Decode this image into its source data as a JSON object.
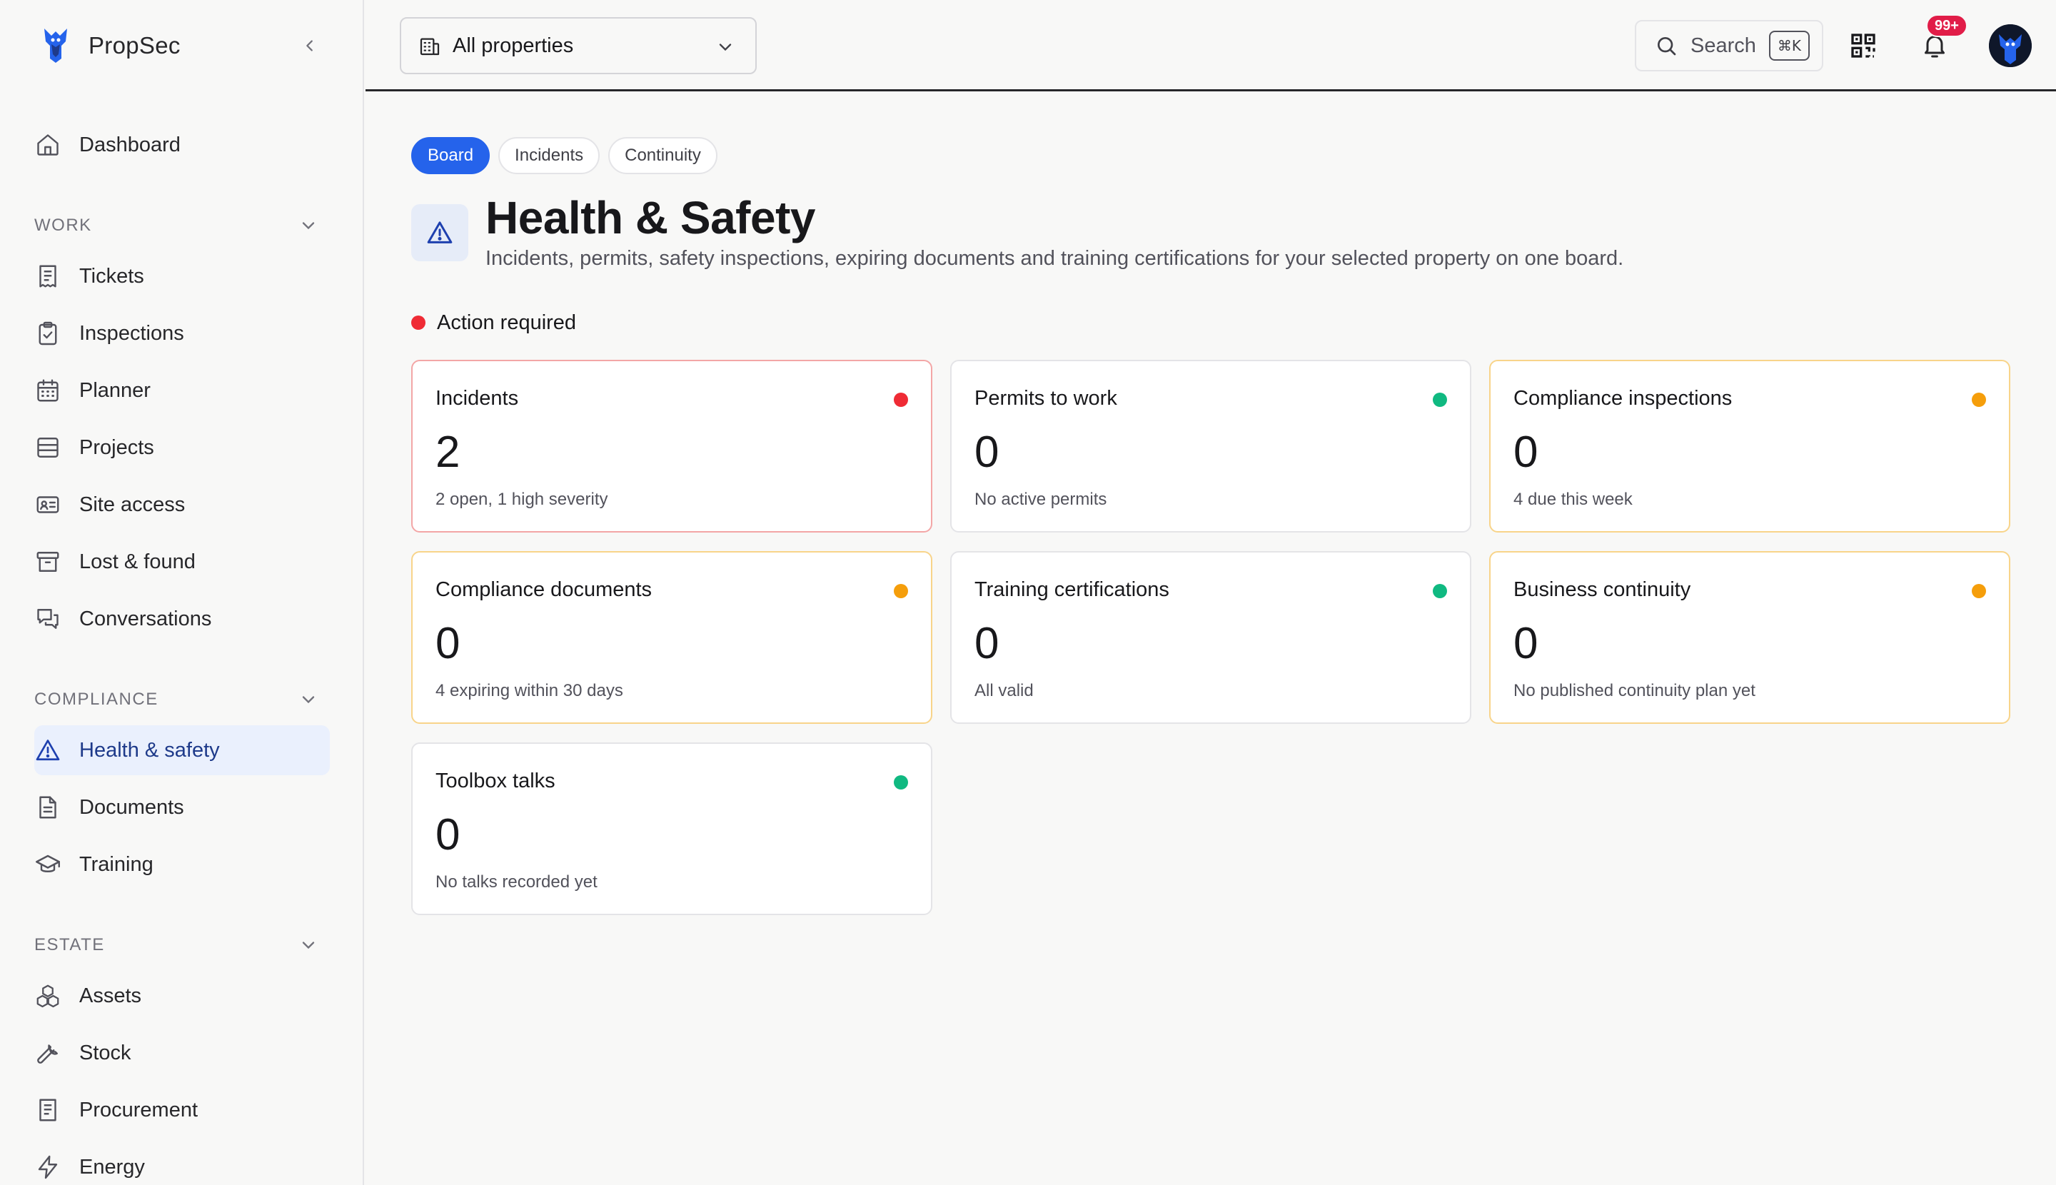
{
  "app": {
    "name": "PropSec"
  },
  "sidebar": {
    "dashboard": "Dashboard",
    "sections": [
      {
        "label": "WORK",
        "items": [
          "Tickets",
          "Inspections",
          "Planner",
          "Projects",
          "Site access",
          "Lost & found",
          "Conversations"
        ]
      },
      {
        "label": "COMPLIANCE",
        "items": [
          "Health & safety",
          "Documents",
          "Training"
        ]
      },
      {
        "label": "ESTATE",
        "items": [
          "Assets",
          "Stock",
          "Procurement",
          "Energy"
        ]
      }
    ],
    "active_item": "Health & safety"
  },
  "topbar": {
    "property_select": "All properties",
    "search_label": "Search",
    "search_shortcut": "⌘K",
    "notification_count": "99+"
  },
  "main": {
    "tabs": [
      "Board",
      "Incidents",
      "Continuity"
    ],
    "active_tab": "Board",
    "title": "Health & Safety",
    "subtitle": "Incidents, permits, safety inspections, expiring documents and training certifications for your selected property on one board.",
    "action_label": "Action required",
    "cards": [
      {
        "title": "Incidents",
        "value": "2",
        "note": "2 open, 1 high severity",
        "status": "red"
      },
      {
        "title": "Permits to work",
        "value": "0",
        "note": "No active permits",
        "status": "green"
      },
      {
        "title": "Compliance inspections",
        "value": "0",
        "note": "4 due this week",
        "status": "amber"
      },
      {
        "title": "Compliance documents",
        "value": "0",
        "note": "4 expiring within 30 days",
        "status": "amber"
      },
      {
        "title": "Training certifications",
        "value": "0",
        "note": "All valid",
        "status": "green"
      },
      {
        "title": "Business continuity",
        "value": "0",
        "note": "No published continuity plan yet",
        "status": "amber"
      },
      {
        "title": "Toolbox talks",
        "value": "0",
        "note": "No talks recorded yet",
        "status": "green"
      }
    ]
  },
  "colors": {
    "accent": "#2563eb",
    "status_red": "#ef2b35",
    "status_green": "#10b981",
    "status_amber": "#f59e0b",
    "badge": "#e11d48"
  }
}
